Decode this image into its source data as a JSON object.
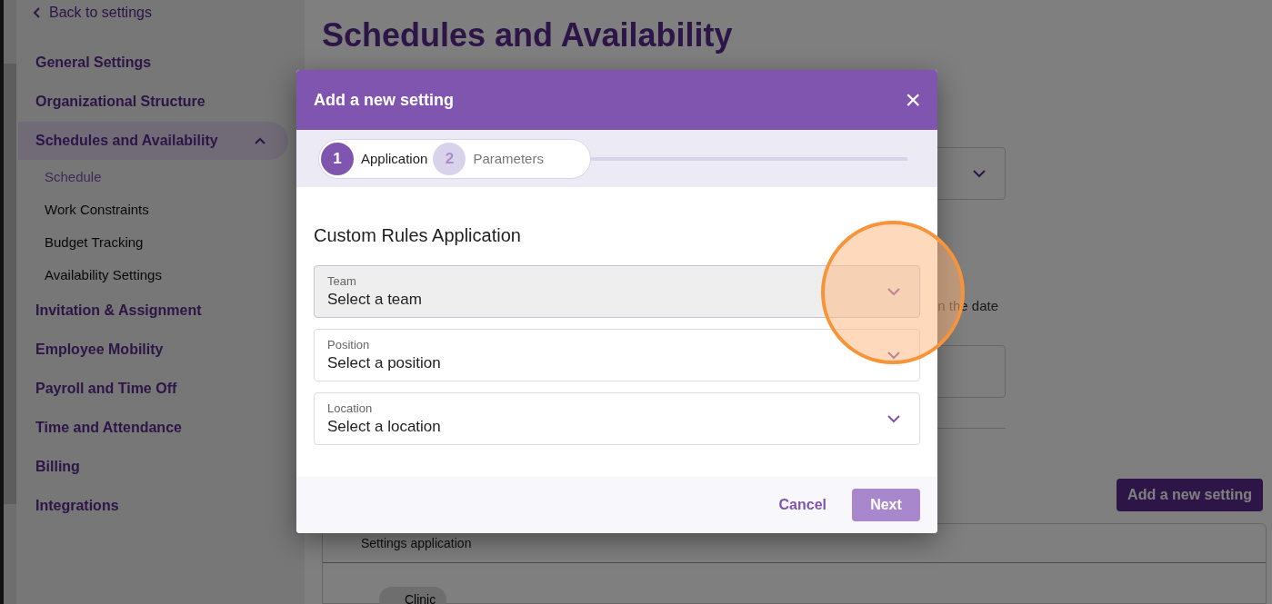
{
  "sidebar": {
    "back_link": "Back to settings",
    "items": [
      {
        "label": "General Settings",
        "selected": false
      },
      {
        "label": "Organizational Structure",
        "selected": false
      },
      {
        "label": "Schedules and Availability",
        "selected": true,
        "expanded": true,
        "children": [
          {
            "label": "Schedule",
            "selected": true
          },
          {
            "label": "Work Constraints",
            "selected": false
          },
          {
            "label": "Budget Tracking",
            "selected": false
          },
          {
            "label": "Availability Settings",
            "selected": false
          }
        ]
      },
      {
        "label": "Invitation & Assignment",
        "selected": false
      },
      {
        "label": "Employee Mobility",
        "selected": false
      },
      {
        "label": "Payroll and Time Off",
        "selected": false
      },
      {
        "label": "Time and Attendance",
        "selected": false
      },
      {
        "label": "Billing",
        "selected": false
      },
      {
        "label": "Integrations",
        "selected": false
      }
    ]
  },
  "page": {
    "title": "Schedules and Availability",
    "description_fragment": "n the date",
    "add_button": "Add a new setting",
    "table": {
      "columns": [
        "Settings application"
      ],
      "rows": [
        {
          "chip": "Clinic"
        }
      ]
    }
  },
  "dialog": {
    "title": "Add a new setting",
    "close": "×",
    "steps": [
      {
        "number": "1",
        "label": "Application",
        "selected": true
      },
      {
        "number": "2",
        "label": "Parameters",
        "selected": false
      }
    ],
    "section_title": "Custom Rules Application",
    "fields": [
      {
        "label": "Team",
        "placeholder": "Select a team",
        "focused": true
      },
      {
        "label": "Position",
        "placeholder": "Select a position",
        "focused": false
      },
      {
        "label": "Location",
        "placeholder": "Select a location",
        "focused": false
      }
    ],
    "buttons": [
      {
        "label": "Cancel",
        "kind": "text"
      },
      {
        "label": "Next",
        "kind": "primary"
      }
    ]
  }
}
